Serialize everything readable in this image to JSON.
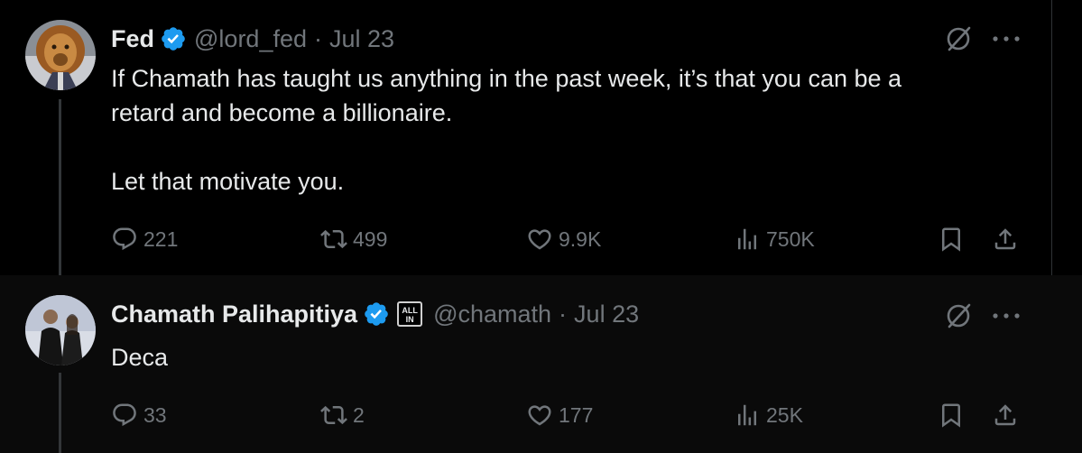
{
  "tweets": [
    {
      "author_name": "Fed",
      "handle": "@lord_fed",
      "separator": "·",
      "date": "Jul 23",
      "text_lines": [
        "If Chamath has taught us anything in the past week, it’s that you can be a",
        "retard and become a billionaire.",
        "",
        "Let that motivate you."
      ],
      "stats": {
        "replies": "221",
        "reposts": "499",
        "likes": "9.9K",
        "views": "750K"
      }
    },
    {
      "author_name": "Chamath Palihapitiya",
      "affiliate_badge": "ALL IN",
      "handle": "@chamath",
      "separator": "·",
      "date": "Jul 23",
      "text_lines": [
        "Deca"
      ],
      "stats": {
        "replies": "33",
        "reposts": "2",
        "likes": "177",
        "views": "25K"
      }
    }
  ],
  "colors": {
    "background": "#000000",
    "text": "#e7e9ea",
    "muted": "#71767b",
    "verified": "#1d9bf0",
    "thread_line": "#333639"
  },
  "icons": [
    "verified-badge-icon",
    "grok-icon",
    "more-icon",
    "reply-icon",
    "repost-icon",
    "like-icon",
    "views-icon",
    "bookmark-icon",
    "share-icon"
  ]
}
